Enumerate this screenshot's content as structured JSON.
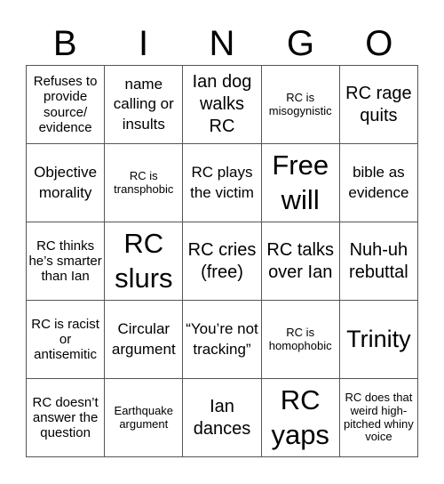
{
  "header": {
    "letters": [
      "B",
      "I",
      "N",
      "G",
      "O"
    ]
  },
  "board": {
    "rows": [
      [
        "Refuses to provide source/ evidence",
        "name calling or insults",
        "Ian dog walks RC",
        "RC is misogynistic",
        "RC rage quits"
      ],
      [
        "Objective morality",
        "RC is transphobic",
        "RC plays the victim",
        "Free will",
        "bible as evidence"
      ],
      [
        "RC thinks he’s smarter than Ian",
        "RC slurs",
        "RC cries (free)",
        "RC talks over Ian",
        "Nuh-uh rebuttal"
      ],
      [
        "RC is racist or antisemitic",
        "Circular argument",
        "“You’re not tracking”",
        "RC is homophobic",
        "Trinity"
      ],
      [
        "RC doesn’t answer the question",
        "Earthquake argument",
        "Ian dances",
        "RC yaps",
        "RC does that weird high-pitched whiny voice"
      ]
    ]
  },
  "colors": {
    "background": "#ffffff",
    "text": "#000000",
    "grid_line": "#555555"
  }
}
